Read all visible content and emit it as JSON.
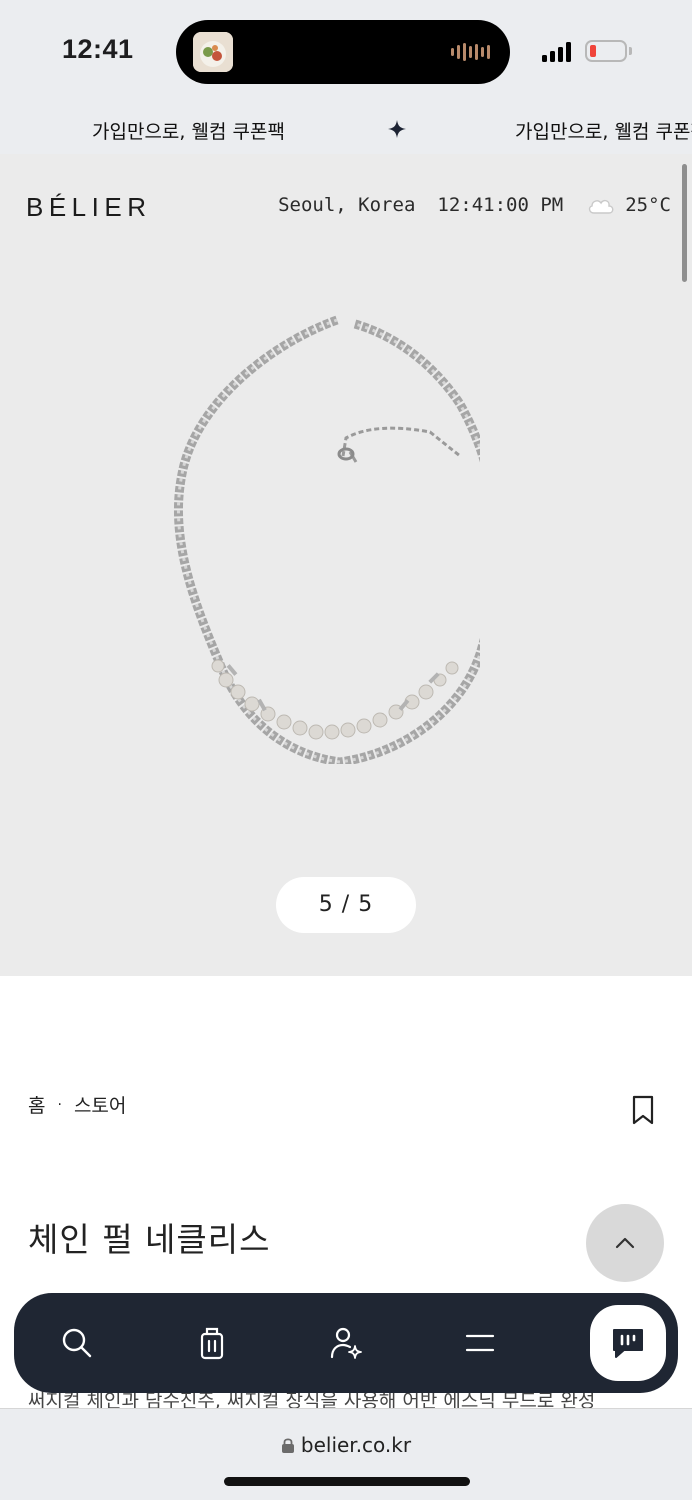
{
  "status_bar": {
    "time": "12:41"
  },
  "banner": {
    "text_primary": "가입만으로, 웰컴 쿠폰팩",
    "text_repeat": "가입만으로, 웰컴 쿠폰팩"
  },
  "header": {
    "logo": "BÉLIER",
    "location": "Seoul, Korea",
    "clock": "12:41:00 PM",
    "weather_icon": "cloud-icon",
    "temperature": "25°C"
  },
  "gallery": {
    "pager": "5 / 5"
  },
  "product": {
    "breadcrumb_home": "홈",
    "breadcrumb_separator": "·",
    "breadcrumb_store": "스토어",
    "title": "체인 펄 네클리스",
    "description": "써지컬 체인과 담수진주, 써지컬 장식을 사용해 어반 에스닉 무드로 완성"
  },
  "bottom_nav": {
    "items": [
      {
        "icon": "search-icon"
      },
      {
        "icon": "shopping-bag-icon"
      },
      {
        "icon": "user-star-icon"
      },
      {
        "icon": "menu-icon"
      },
      {
        "icon": "chat-icon"
      }
    ]
  },
  "browser": {
    "url": "belier.co.kr"
  },
  "colors": {
    "nav_background": "#1f2633",
    "gallery_background": "#ebebeb",
    "battery_low": "#f0443a"
  }
}
